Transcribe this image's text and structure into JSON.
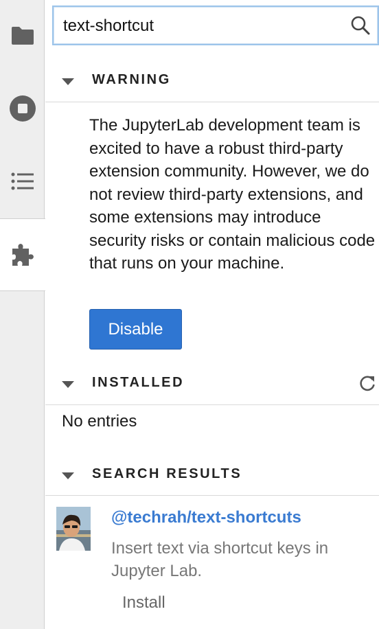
{
  "activity_bar": {
    "items": [
      {
        "icon": "folder-icon"
      },
      {
        "icon": "stop-circle-icon"
      },
      {
        "icon": "list-icon"
      },
      {
        "icon": "puzzle-icon",
        "active": true
      }
    ]
  },
  "search": {
    "value": "text-shortcut",
    "icon": "search-icon"
  },
  "warning": {
    "title": "WARNING",
    "text": "The JupyterLab development team is excited to have a robust third-party extension community. However, we do not review third-party extensions, and some extensions may introduce security risks or contain malicious code that runs on your machine.",
    "button_label": "Disable"
  },
  "installed": {
    "title": "INSTALLED",
    "empty_text": "No entries"
  },
  "search_results": {
    "title": "SEARCH RESULTS",
    "items": [
      {
        "name": "@techrah/text-shortcuts",
        "description": "Insert text via shortcut keys in Jupyter Lab.",
        "action_label": "Install"
      }
    ]
  },
  "colors": {
    "accent": "#2f76d2",
    "link": "#3a7bd1",
    "muted_text": "#777777",
    "sidebar_bg": "#eeeeee"
  }
}
